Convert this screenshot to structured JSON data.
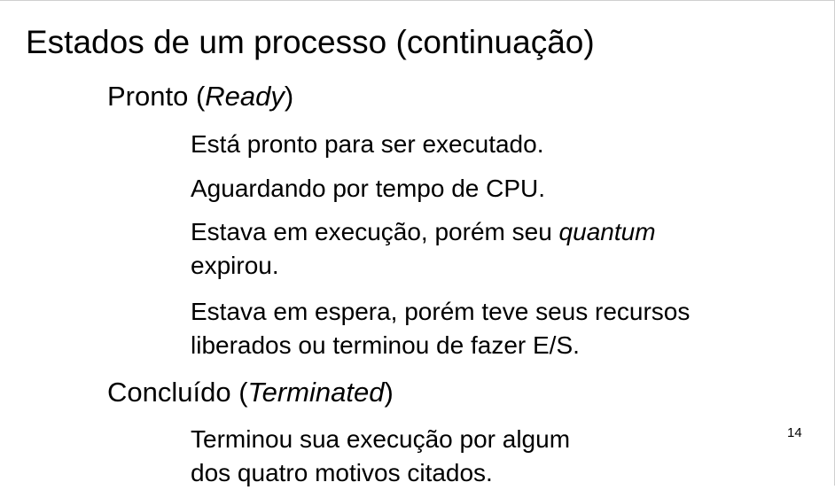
{
  "title": "Estados de um processo (continuação)",
  "sections": [
    {
      "heading_prefix": "Pronto (",
      "heading_emphasis": "Ready",
      "heading_suffix": ")",
      "items": [
        {
          "text": "Está pronto para ser executado."
        },
        {
          "text": "Aguardando por tempo de CPU."
        },
        {
          "text_prefix": "Estava em execução, porém seu ",
          "text_emphasis": "quantum",
          "text_line2": "expirou."
        },
        {
          "line1": "Estava em espera, porém teve seus recursos",
          "line2": "liberados ou terminou de fazer E/S."
        }
      ]
    },
    {
      "heading_prefix": "Concluído (",
      "heading_emphasis": "Terminated",
      "heading_suffix": ")",
      "items": [
        {
          "line1": "Terminou sua execução por algum",
          "line2": "dos quatro motivos citados."
        }
      ]
    }
  ],
  "page_number": "14"
}
